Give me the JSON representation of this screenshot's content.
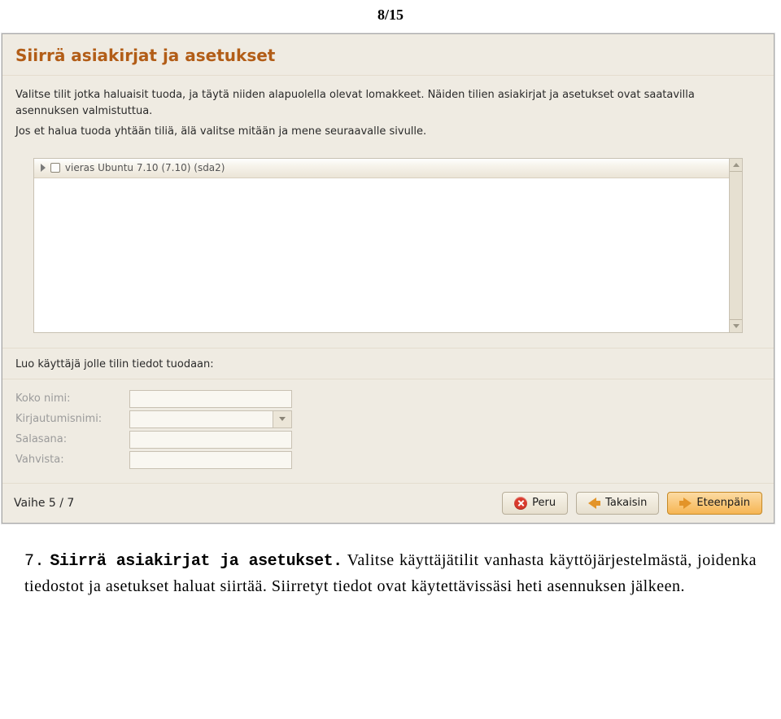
{
  "page_number": "8/15",
  "installer": {
    "title": "Siirrä asiakirjat ja asetukset",
    "intro1": "Valitse tilit jotka haluaisit tuoda, ja täytä niiden alapuolella olevat lomakkeet. Näiden tilien asiakirjat ja asetukset ovat saatavilla asennuksen valmistuttua.",
    "intro2": "Jos et halua tuoda yhtään tiliä, älä valitse mitään ja mene seuraavalle sivulle.",
    "list_item": "vieras  Ubuntu 7.10 (7.10) (sda2)",
    "subheading": "Luo käyttäjä jolle tilin tiedot tuodaan:",
    "fields": {
      "fullname": "Koko nimi:",
      "loginname": "Kirjautumisnimi:",
      "password": "Salasana:",
      "confirm": "Vahvista:"
    },
    "step": "Vaihe 5 / 7",
    "buttons": {
      "cancel": "Peru",
      "back": "Takaisin",
      "forward": "Eteenpäin"
    }
  },
  "caption": {
    "num": "7.",
    "lead": "Siirrä asiakirjat ja asetukset.",
    "rest": " Valitse käyttäjätilit vanhasta käyttöjärjestelmästä, joidenka tiedostot ja asetukset haluat siirtää. Siirretyt tiedot ovat käytettävissäsi heti asennuksen jälkeen."
  }
}
